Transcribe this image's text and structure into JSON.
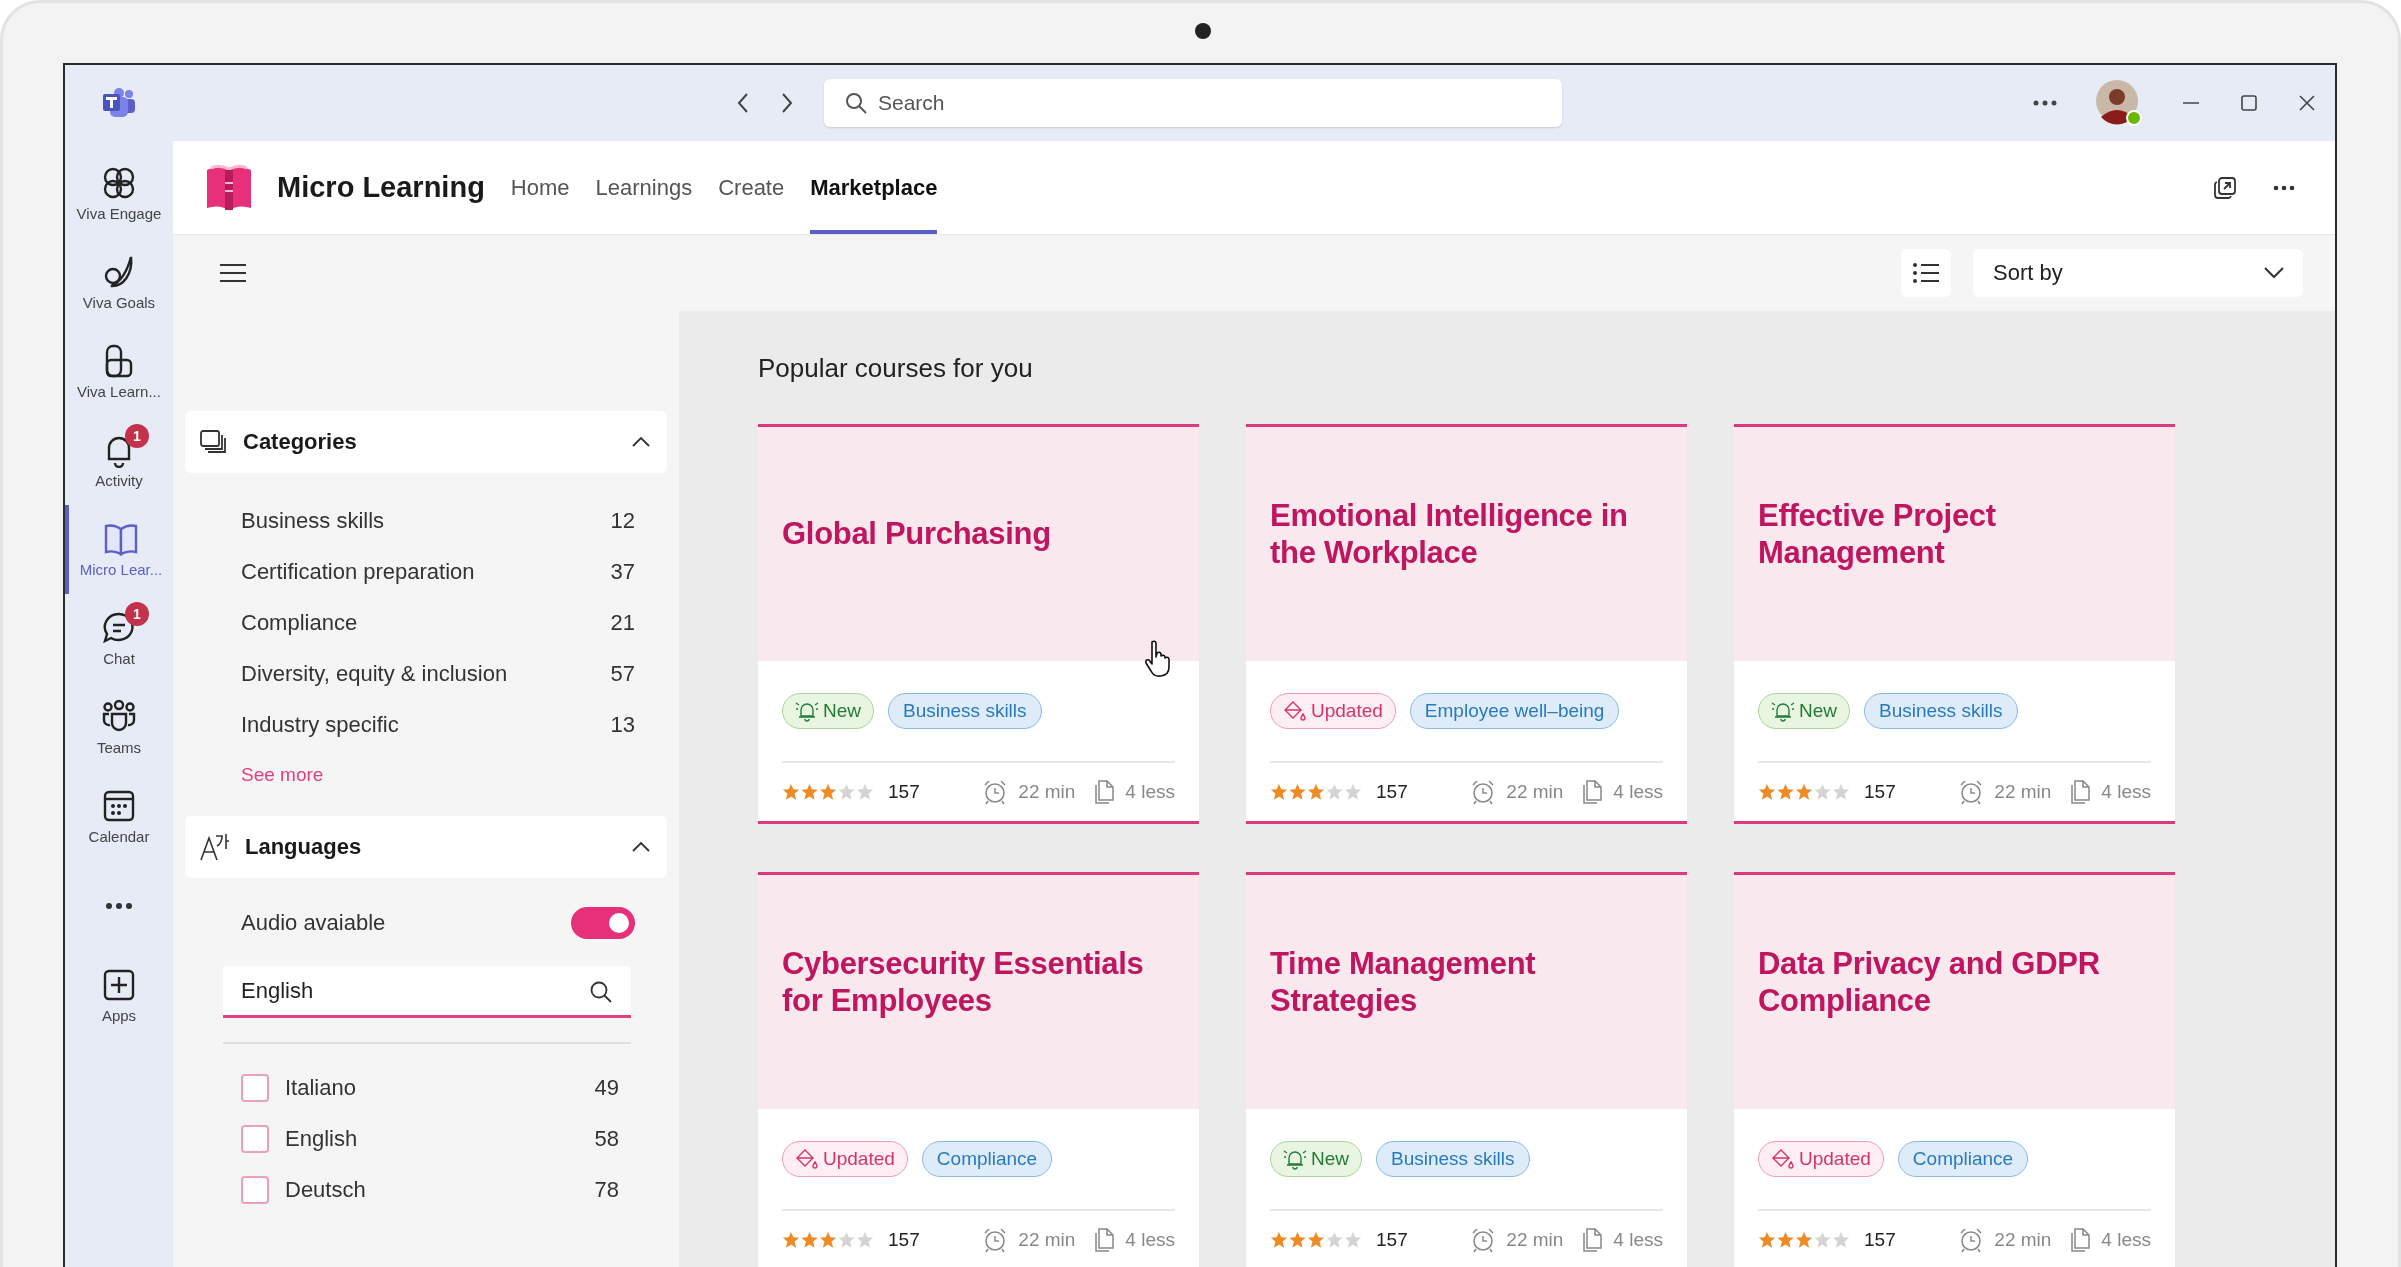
{
  "titlebar": {
    "search": {
      "placeholder": "Search"
    }
  },
  "rail": [
    {
      "kind": "engage",
      "label": "Viva Engage",
      "selected": false
    },
    {
      "kind": "goals",
      "label": "Viva Goals",
      "selected": false
    },
    {
      "kind": "learning",
      "label": "Viva Learn...",
      "selected": false
    },
    {
      "kind": "activity",
      "label": "Activity",
      "selected": false,
      "badge": "1"
    },
    {
      "kind": "book",
      "label": "Micro Lear...",
      "selected": true
    },
    {
      "kind": "chat",
      "label": "Chat",
      "selected": false,
      "badge": "1"
    },
    {
      "kind": "teams",
      "label": "Teams",
      "selected": false
    },
    {
      "kind": "calendar",
      "label": "Calendar",
      "selected": false
    },
    {
      "kind": "more"
    },
    {
      "kind": "apps",
      "label": "Apps",
      "selected": false
    }
  ],
  "app": {
    "title": "Micro Learning",
    "nav": [
      {
        "label": "Home",
        "selected": false
      },
      {
        "label": "Learnings",
        "selected": false
      },
      {
        "label": "Create",
        "selected": false
      },
      {
        "label": "Marketplace",
        "selected": true
      }
    ]
  },
  "toolbar": {
    "sort": {
      "label": "Sort by"
    }
  },
  "categories": {
    "title": "Categories",
    "expanded": true,
    "items": [
      {
        "label": "Business skills",
        "count": "12"
      },
      {
        "label": "Certification preparation",
        "count": "37"
      },
      {
        "label": "Compliance",
        "count": "21"
      },
      {
        "label": "Diversity, equity & inclusion",
        "count": "57"
      },
      {
        "label": "Industry specific",
        "count": "13"
      }
    ],
    "see_more": "See more"
  },
  "languages": {
    "title": "Languages",
    "expanded": true,
    "audio": {
      "label": "Audio avaiable",
      "on": true
    },
    "search": {
      "value": "English"
    },
    "items": [
      {
        "label": "Italiano",
        "count": "49",
        "checked": false
      },
      {
        "label": "English",
        "count": "58",
        "checked": false
      },
      {
        "label": "Deutsch",
        "count": "78",
        "checked": false
      }
    ]
  },
  "section_title": "Popular courses for you",
  "courses": [
    {
      "title": "Global Purchasing",
      "status": {
        "kind": "new",
        "label": "New"
      },
      "category": "Business skills",
      "stars": 3,
      "ratings": "157",
      "duration": "22 min",
      "lessons": "4 less"
    },
    {
      "title": "Emotional Intelligence in the Workplace",
      "status": {
        "kind": "updated",
        "label": "Updated"
      },
      "category": "Employee well–being",
      "stars": 3,
      "ratings": "157",
      "duration": "22 min",
      "lessons": "4 less"
    },
    {
      "title": "Effective Project Management",
      "status": {
        "kind": "new",
        "label": "New"
      },
      "category": "Business skills",
      "stars": 3,
      "ratings": "157",
      "duration": "22 min",
      "lessons": "4 less"
    },
    {
      "title": "Cybersecurity Essentials for Employees",
      "status": {
        "kind": "updated",
        "label": "Updated"
      },
      "category": "Compliance",
      "stars": 3,
      "ratings": "157",
      "duration": "22 min",
      "lessons": "4 less"
    },
    {
      "title": "Time Management Strategies",
      "status": {
        "kind": "new",
        "label": "New"
      },
      "category": "Business skills",
      "stars": 3,
      "ratings": "157",
      "duration": "22 min",
      "lessons": "4 less"
    },
    {
      "title": "Data Privacy and GDPR Compliance",
      "status": {
        "kind": "updated",
        "label": "Updated"
      },
      "category": "Compliance",
      "stars": 3,
      "ratings": "157",
      "duration": "22 min",
      "lessons": "4 less"
    }
  ]
}
